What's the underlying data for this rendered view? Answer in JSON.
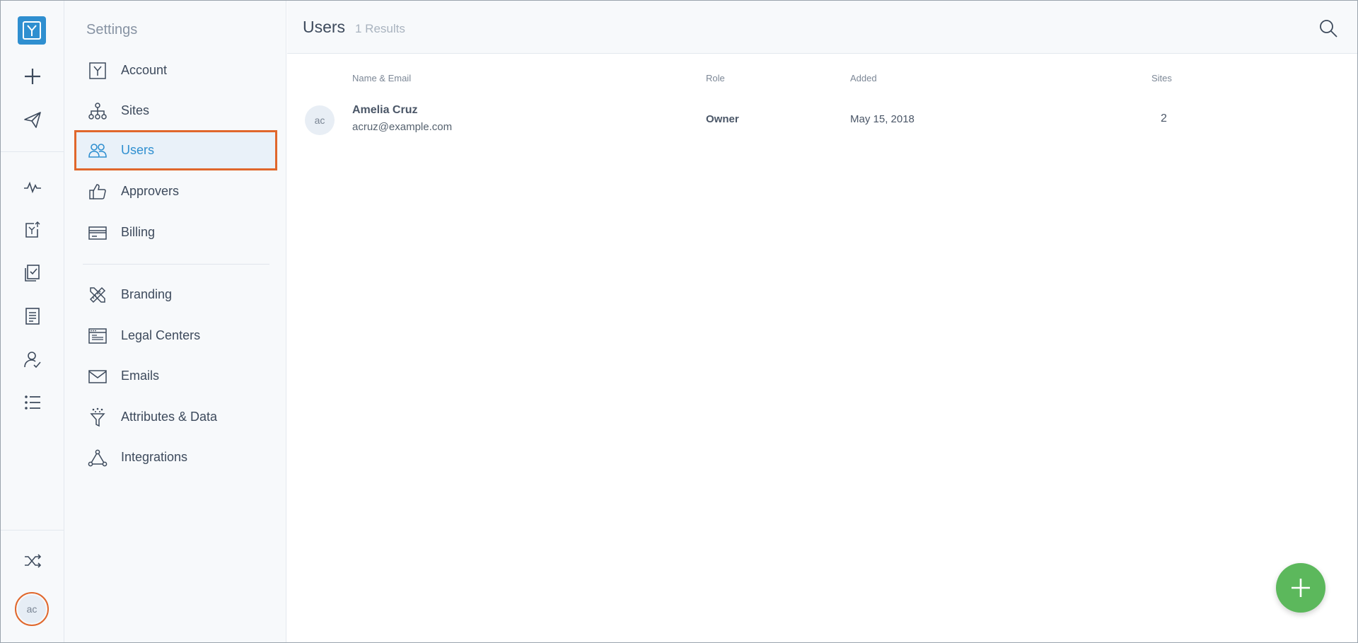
{
  "rail": {
    "icons": [
      "app-logo",
      "plus-icon",
      "paper-plane-icon",
      "activity-icon",
      "export-icon",
      "checklist-icon",
      "document-icon",
      "user-check-icon",
      "list-icon",
      "shuffle-icon"
    ],
    "user_initials": "ac"
  },
  "sidebar": {
    "title": "Settings",
    "items": [
      {
        "label": "Account",
        "icon": "account-icon"
      },
      {
        "label": "Sites",
        "icon": "sitemap-icon"
      },
      {
        "label": "Users",
        "icon": "users-icon",
        "active": true
      },
      {
        "label": "Approvers",
        "icon": "thumbs-up-icon"
      },
      {
        "label": "Billing",
        "icon": "credit-card-icon"
      },
      {
        "label": "Branding",
        "icon": "pencil-ruler-icon"
      },
      {
        "label": "Legal Centers",
        "icon": "browser-window-icon"
      },
      {
        "label": "Emails",
        "icon": "envelope-icon"
      },
      {
        "label": "Attributes & Data",
        "icon": "funnel-icon"
      },
      {
        "label": "Integrations",
        "icon": "integrations-icon"
      }
    ]
  },
  "header": {
    "title": "Users",
    "count": "1 Results"
  },
  "table": {
    "columns": {
      "name_email": "Name & Email",
      "role": "Role",
      "added": "Added",
      "sites": "Sites"
    },
    "rows": [
      {
        "initials": "ac",
        "name": "Amelia Cruz",
        "email": "acruz@example.com",
        "role": "Owner",
        "added": "May 15, 2018",
        "sites": "2"
      }
    ]
  },
  "colors": {
    "accent": "#2f8fd0",
    "highlight": "#e0672c",
    "fab": "#5cb85c"
  }
}
